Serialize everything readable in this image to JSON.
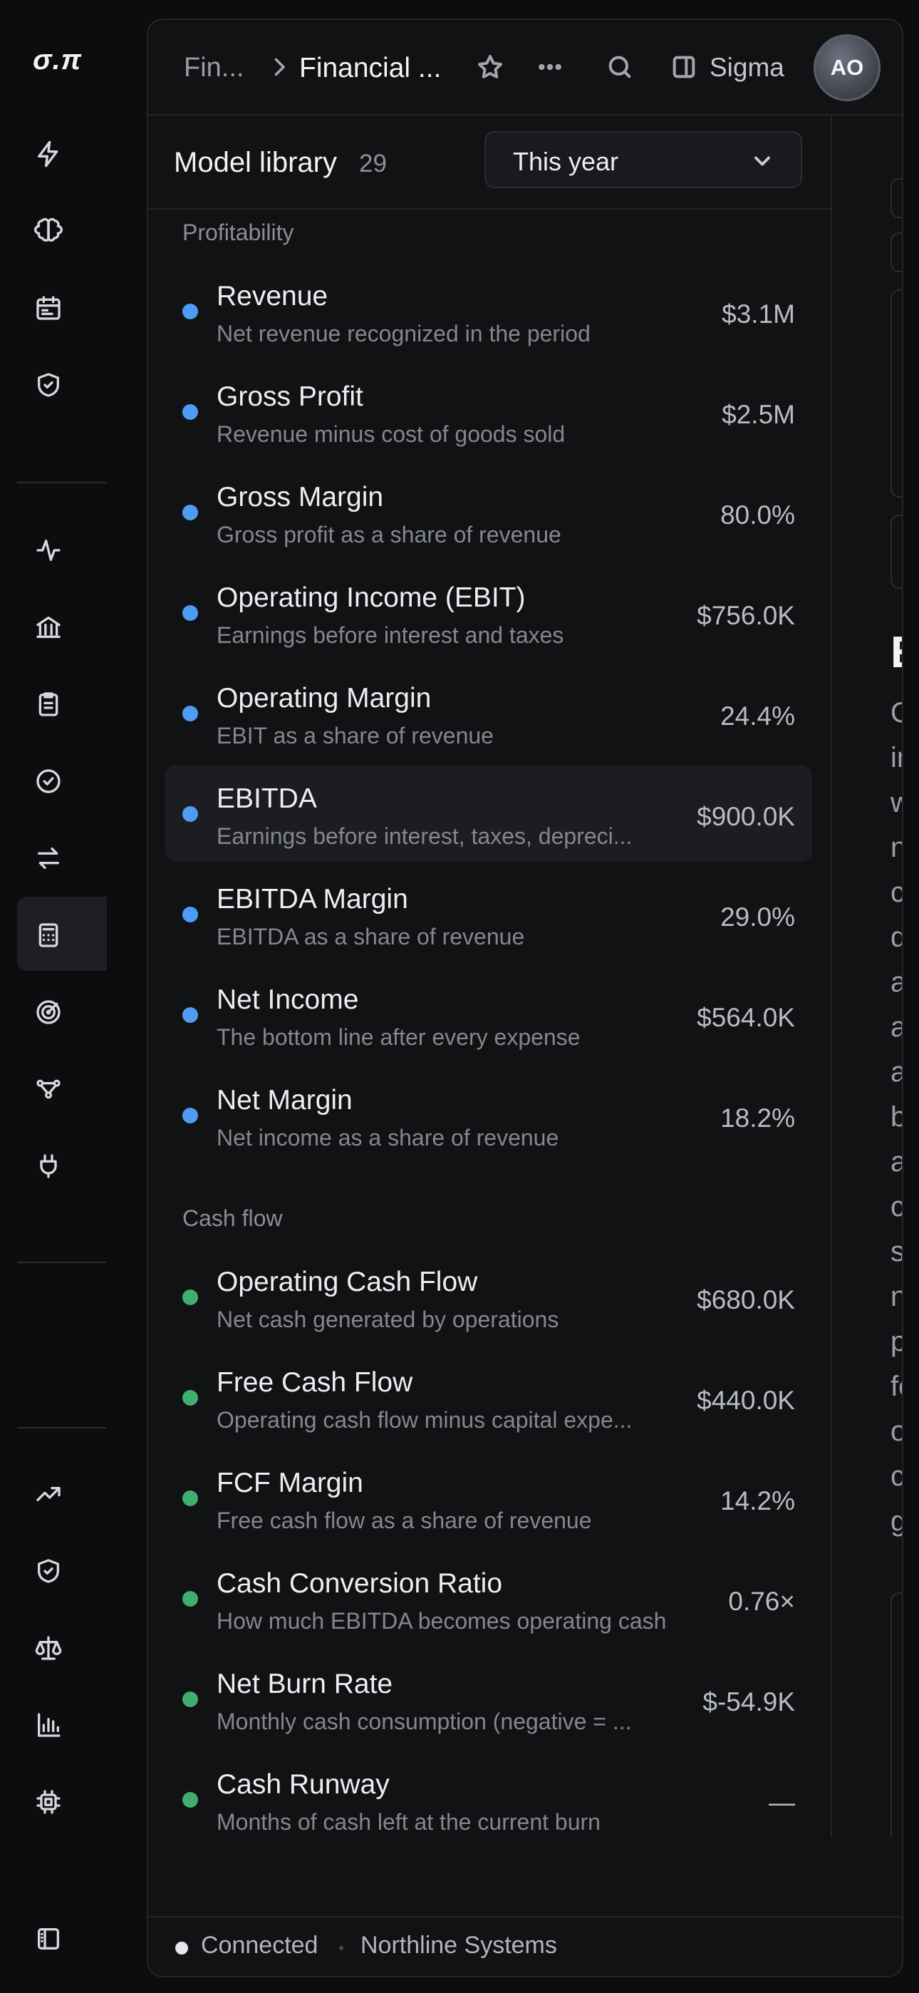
{
  "app": {
    "logo": "σ.π"
  },
  "header": {
    "crumb_parent": "Fin...",
    "crumb_current": "Financial ...",
    "workspace": "Sigma",
    "avatar_initials": "AO"
  },
  "library": {
    "title": "Model library",
    "count": "29",
    "period": "This year"
  },
  "sections": [
    {
      "label": "Profitability",
      "color": "#4f9cf5",
      "items": [
        {
          "title": "Revenue",
          "desc": "Net revenue recognized in the period",
          "value": "$3.1M"
        },
        {
          "title": "Gross Profit",
          "desc": "Revenue minus cost of goods sold",
          "value": "$2.5M"
        },
        {
          "title": "Gross Margin",
          "desc": "Gross profit as a share of revenue",
          "value": "80.0%"
        },
        {
          "title": "Operating Income (EBIT)",
          "desc": "Earnings before interest and taxes",
          "value": "$756.0K"
        },
        {
          "title": "Operating Margin",
          "desc": "EBIT as a share of revenue",
          "value": "24.4%"
        },
        {
          "title": "EBITDA",
          "desc": "Earnings before interest, taxes, depreci...",
          "value": "$900.0K",
          "selected": true
        },
        {
          "title": "EBITDA Margin",
          "desc": "EBITDA as a share of revenue",
          "value": "29.0%"
        },
        {
          "title": "Net Income",
          "desc": "The bottom line after every expense",
          "value": "$564.0K"
        },
        {
          "title": "Net Margin",
          "desc": "Net income as a share of revenue",
          "value": "18.2%"
        }
      ]
    },
    {
      "label": "Cash flow",
      "color": "#3fae6f",
      "items": [
        {
          "title": "Operating Cash Flow",
          "desc": "Net cash generated by operations",
          "value": "$680.0K"
        },
        {
          "title": "Free Cash Flow",
          "desc": "Operating cash flow minus capital expe...",
          "value": "$440.0K"
        },
        {
          "title": "FCF Margin",
          "desc": "Free cash flow as a share of revenue",
          "value": "14.2%"
        },
        {
          "title": "Cash Conversion Ratio",
          "desc": "How much EBITDA becomes operating cash",
          "value": "0.76×"
        },
        {
          "title": "Net Burn Rate",
          "desc": "Monthly cash consumption (negative = ...",
          "value": "$-54.9K"
        },
        {
          "title": "Cash Runway",
          "desc": "Months of cash left at the current burn",
          "value": "—"
        }
      ]
    }
  ],
  "detail_preview": {
    "heading": "E",
    "lines": [
      "O",
      "in",
      "w",
      "n",
      "c",
      "d",
      "a",
      "a",
      "a",
      "b",
      "a",
      "c",
      "st",
      "n",
      "p",
      "fo",
      "o",
      "c",
      "g"
    ]
  },
  "footer": {
    "status": "Connected",
    "org": "Northline Systems"
  }
}
